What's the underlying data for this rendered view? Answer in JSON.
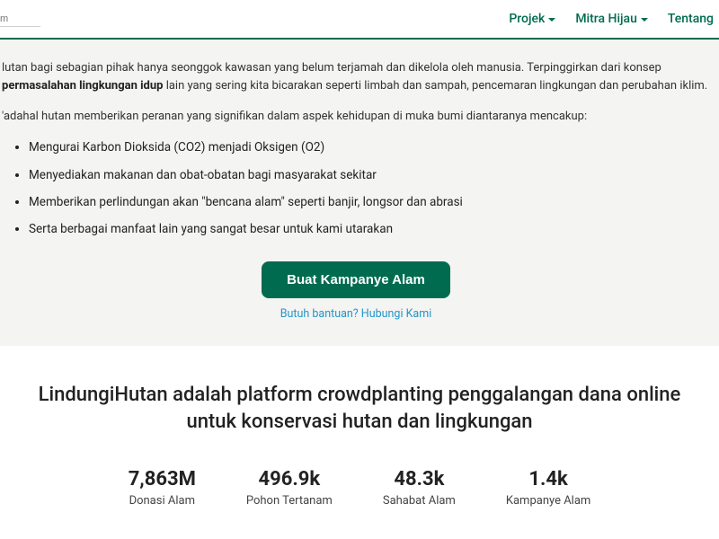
{
  "topbar": {
    "search_placeholder": "m",
    "nav": {
      "projek": "Projek",
      "mitra": "Mitra Hijau",
      "tentang": "Tentang"
    }
  },
  "content": {
    "para1_a": "lutan bagi sebagian pihak hanya seonggok kawasan yang belum terjamah dan dikelola oleh manusia. Terpinggirkan dari konsep ",
    "para1_bold": "permasalahan lingkungan idup",
    "para1_b": " lain yang sering kita bicarakan seperti limbah dan sampah, pencemaran lingkungan dan perubahan iklim.",
    "para2": "'adahal hutan memberikan peranan yang signifikan dalam aspek kehidupan di muka bumi diantaranya mencakup:",
    "bullets": [
      "Mengurai Karbon Dioksida (CO2) menjadi Oksigen (O2)",
      "Menyediakan makanan dan obat-obatan bagi masyarakat sekitar",
      "Memberikan perlindungan akan \"bencana alam\" seperti banjir, longsor dan abrasi",
      "Serta berbagai manfaat lain yang sangat besar untuk kami utarakan"
    ],
    "cta_label": "Buat Kampanye Alam",
    "help_label": "Butuh bantuan? Hubungi Kami"
  },
  "platform": {
    "headline": "LindungiHutan adalah platform crowdplanting penggalangan dana online untuk konservasi hutan dan lingkungan",
    "stats": [
      {
        "value": "7,863M",
        "label": "Donasi Alam"
      },
      {
        "value": "496.9k",
        "label": "Pohon Tertanam"
      },
      {
        "value": "48.3k",
        "label": "Sahabat Alam"
      },
      {
        "value": "1.4k",
        "label": "Kampanye Alam"
      }
    ]
  }
}
